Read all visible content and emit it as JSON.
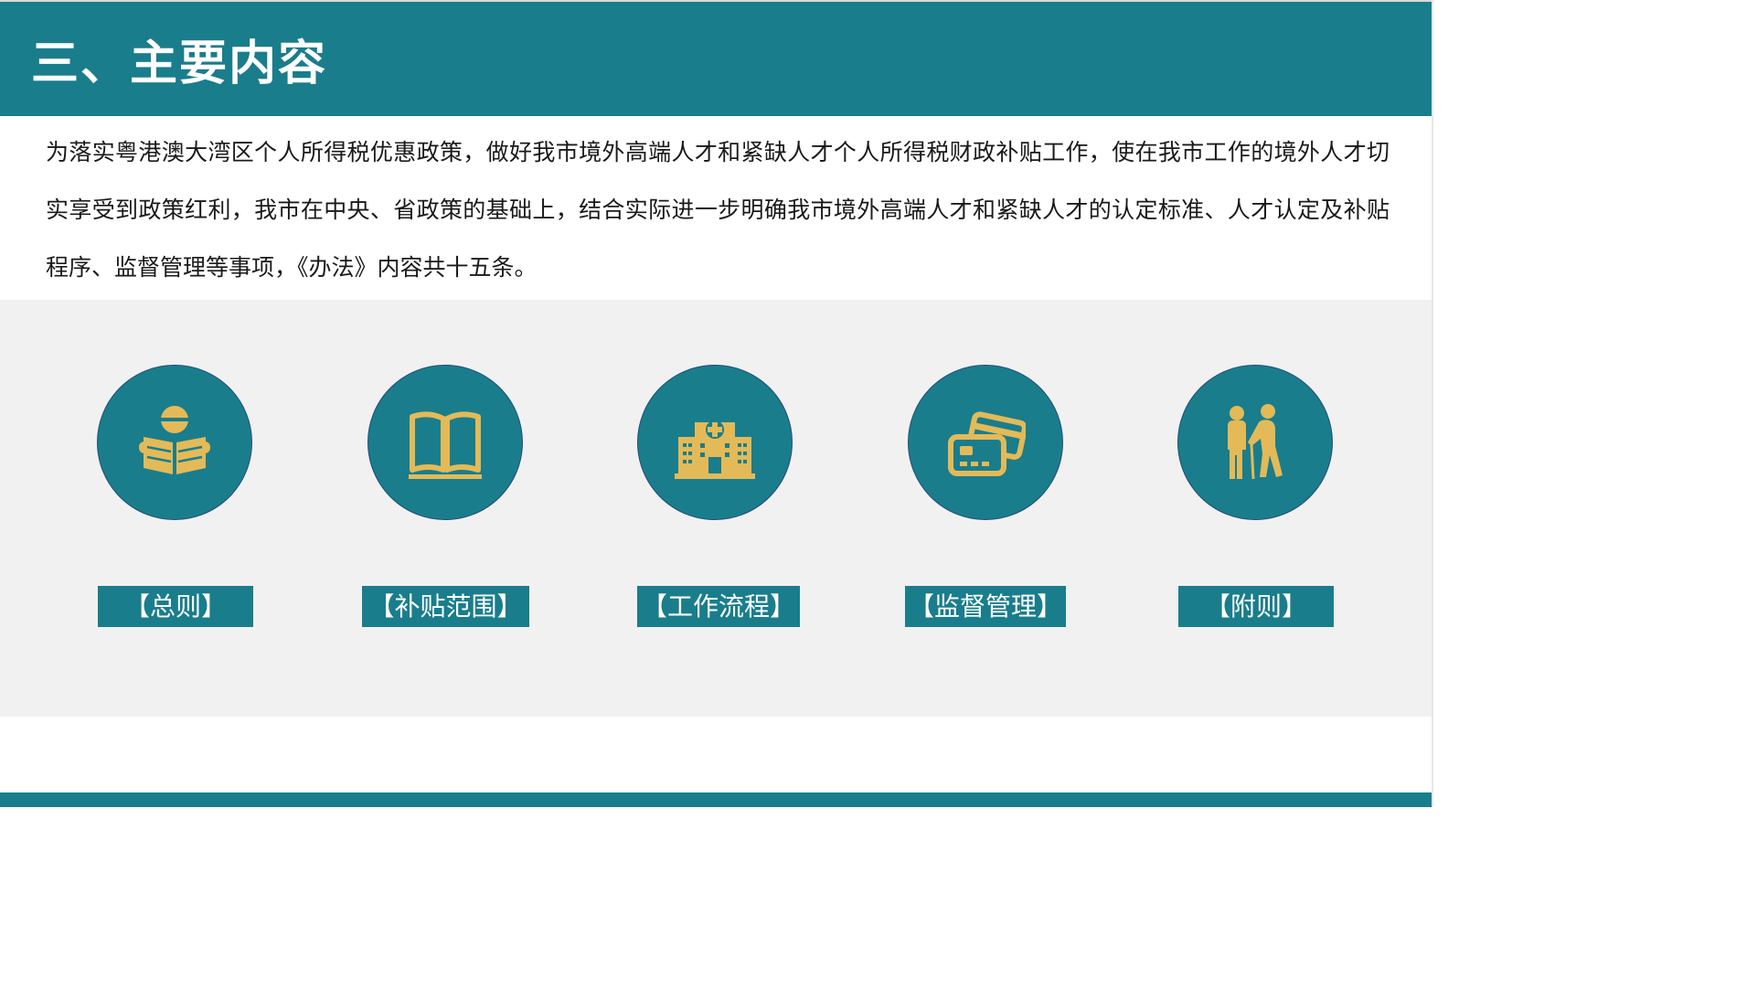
{
  "header": {
    "title": "三、主要内容"
  },
  "intro": {
    "text": "为落实粤港澳大湾区个人所得税优惠政策，做好我市境外高端人才和紧缺人才个人所得税财政补贴工作，使在我市工作的境外人才切实享受到政策红利，我市在中央、省政策的基础上，结合实际进一步明确我市境外高端人才和紧缺人才的认定标准、人才认定及补贴程序、监督管理等事项，《办法》内容共十五条。"
  },
  "sections": [
    {
      "label": "【总则】",
      "icon": "reading-person-icon"
    },
    {
      "label": "【补贴范围】",
      "icon": "open-book-icon"
    },
    {
      "label": "【工作流程】",
      "icon": "hospital-building-icon"
    },
    {
      "label": "【监督管理】",
      "icon": "cards-icon"
    },
    {
      "label": "【附则】",
      "icon": "assisting-elderly-icon"
    }
  ],
  "colors": {
    "teal": "#1a7d8c",
    "gold": "#e3ba57",
    "panel_gray": "#f1f1f1",
    "circle_border": "#1f4e79"
  }
}
